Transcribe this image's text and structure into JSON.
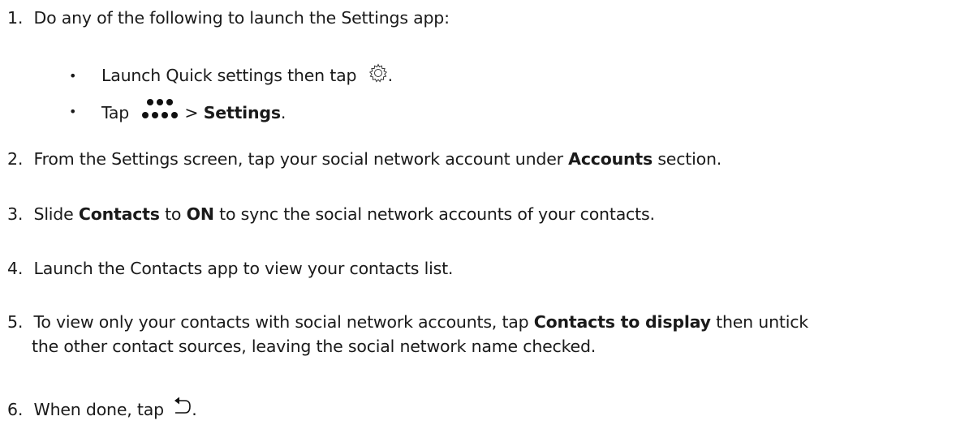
{
  "steps": [
    {
      "number": "1.",
      "text": "Do any of the following to launch the Settings app:"
    },
    {
      "number": "2.",
      "pre": "From the Settings screen, tap your social network account under ",
      "bold": "Accounts",
      "post": " section."
    },
    {
      "number": "3.",
      "pre": "Slide ",
      "bold1": "Contacts",
      "mid": " to ",
      "bold2": "ON",
      "post": " to sync the social network accounts of your contacts."
    },
    {
      "number": "4.",
      "text": "Launch the Contacts app to view your contacts list."
    },
    {
      "number": "5.",
      "pre": "To view only your contacts with social network accounts, tap ",
      "bold": "Contacts to display",
      "post": " then untick",
      "line2": "the other contact sources, leaving the social network name checked."
    },
    {
      "number": "6.",
      "pre": "When done, tap ",
      "post": "."
    }
  ],
  "bullets": [
    {
      "marker": "•",
      "pre": "Launch Quick settings then tap ",
      "icon": "gear-icon",
      "post": "."
    },
    {
      "marker": "•",
      "pre": "Tap ",
      "icon": "more-dots-icon",
      "mid": "> ",
      "bold": "Settings",
      "post": "."
    }
  ]
}
